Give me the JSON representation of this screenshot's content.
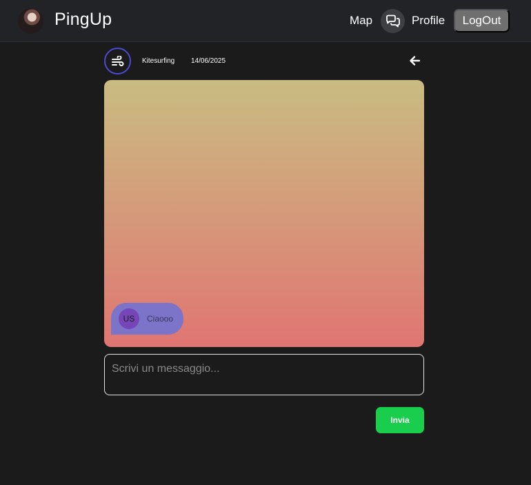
{
  "navbar": {
    "brand_name": "PingUp",
    "avatar_icon": "user-avatar-photo",
    "links": {
      "map": "Map",
      "profile": "Profile",
      "logout": "LogOut"
    },
    "chat_icon": "chat-bubbles-icon"
  },
  "chat": {
    "activity_icon": "wind-icon",
    "activity_name": "Kitesurfing",
    "date": "14/06/2025",
    "back_icon": "arrow-left-icon",
    "messages": [
      {
        "avatar_initials": "US",
        "text": "Ciaooo"
      }
    ],
    "input_placeholder": "Scrivi un messaggio...",
    "send_label": "Invia"
  },
  "colors": {
    "navbar_bg": "#212327",
    "page_bg": "#1b1b1b",
    "gradient_top": "#c9bc82",
    "gradient_bottom": "#e07572",
    "message_bubble": "#7b74c8",
    "send_button": "#19cd4d",
    "activity_ring": "#4b4bd6"
  }
}
